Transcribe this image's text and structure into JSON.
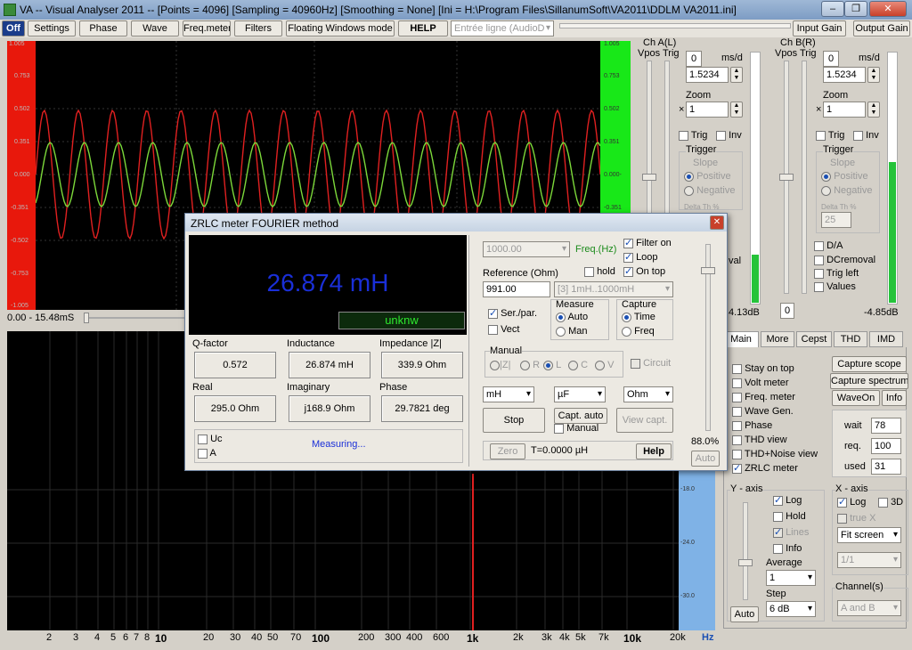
{
  "window": {
    "title": "VA -- Visual Analyser 2011 --  [Points = 4096]  [Sampling = 40960Hz]  [Smoothing = None]  [Ini = H:\\Program Files\\SillanumSoft\\VA2011\\DDLM VA2011.ini]",
    "minimize": "–",
    "maximize": "❐",
    "close": "✕"
  },
  "toolbar": {
    "off": "Off",
    "settings": "Settings",
    "phase": "Phase",
    "wave": "Wave",
    "freqmeter": "Freq.meter",
    "filters": "Filters",
    "floating": "Floating Windows mode",
    "help": "HELP",
    "input_select": "Entrée ligne (AudioD",
    "input_gain": "Input Gain",
    "output_gain": "Output Gain"
  },
  "scope": {
    "left_ticks": [
      "1.005",
      "0.753",
      "0.502",
      "0.351",
      "0.000",
      "-0.351",
      "-0.502",
      "-0.753",
      "-1.005"
    ],
    "right_ticks": [
      "1.005",
      "0.753",
      "0.502",
      "0.351",
      "0.000-",
      "-0.351"
    ],
    "time_range": "0.00 - 15.48mS"
  },
  "chA": {
    "title": "Ch A(L)",
    "vpos": "Vpos",
    "trig": "Trig",
    "ms_d_val": "0",
    "ms_d": "ms/d",
    "time": "1.5234",
    "zoom": "Zoom",
    "zoom_x": "×",
    "zoom_val": "1",
    "trig_cb": "Trig",
    "inv_cb": "Inv",
    "trigger": "Trigger",
    "slope": "Slope",
    "positive": "Positive",
    "negative": "Negative",
    "delta": "Delta Th %",
    "val_label": "val",
    "db": "4.13dB"
  },
  "chB": {
    "title": "Ch B(R)",
    "vpos": "Vpos",
    "trig": "Trig",
    "ms_d_val": "0",
    "ms_d": "ms/d",
    "time": "1.5234",
    "zoom": "Zoom",
    "zoom_x": "×",
    "zoom_val": "1",
    "trig_cb": "Trig",
    "inv_cb": "Inv",
    "trigger": "Trigger",
    "slope": "Slope",
    "positive": "Positive",
    "negative": "Negative",
    "delta": "Delta Th %",
    "delta_val": "25",
    "da": "D/A",
    "dcremoval": "DCremoval",
    "trigleft": "Trig left",
    "values": "Values",
    "zero": "0",
    "db": "-4.85dB"
  },
  "spectrum": {
    "db_ticks": [
      "-18.0",
      "-24.0",
      "-30.0"
    ],
    "x_ticks": [
      "2",
      "3",
      "4",
      "5",
      "6",
      "7",
      "8",
      "10",
      "20",
      "30",
      "40",
      "50",
      "70",
      "100",
      "200",
      "300",
      "400",
      "600",
      "1k",
      "2k",
      "3k",
      "4k",
      "5k",
      "7k",
      "10k",
      "20k"
    ],
    "hz": "Hz"
  },
  "tabs": [
    "Main",
    "More",
    "Cepst",
    "THD",
    "IMD"
  ],
  "main": {
    "stay_on_top": "Stay on top",
    "volt_meter": "Volt meter",
    "freq_meter": "Freq. meter",
    "wave_gen": "Wave Gen.",
    "phase": "Phase",
    "thd_view": "THD view",
    "thd_noise": "THD+Noise view",
    "zrlc": "ZRLC meter",
    "capt_scope": "Capture scope",
    "capt_spectrum": "Capture spectrum",
    "waveon": "WaveOn",
    "info": "Info",
    "wait_label": "wait",
    "wait": "78",
    "req_label": "req.",
    "req": "100",
    "used_label": "used",
    "used": "31"
  },
  "yaxis": {
    "title": "Y - axis",
    "log": "Log",
    "hold": "Hold",
    "lines": "Lines",
    "info": "Info",
    "average": "Average",
    "avg_val": "1",
    "step": "Step",
    "step_val": "6 dB",
    "auto": "Auto"
  },
  "xaxis": {
    "title": "X - axis",
    "log": "Log",
    "three_d": "3D",
    "truex": "true X",
    "fit": "Fit screen",
    "ratio": "1/1",
    "channels": "Channel(s)",
    "ch_val": "A and B"
  },
  "dialog": {
    "title": "ZRLC meter FOURIER method",
    "close": "✕",
    "value": "26.874 mH",
    "status": "unknw",
    "q_label": "Q-factor",
    "q": "0.572",
    "ind_label": "Inductance",
    "ind": "26.874 mH",
    "imp_label": "Impedance |Z|",
    "imp": "339.9 Ohm",
    "real_label": "Real",
    "real": "295.0 Ohm",
    "imag_label": "Imaginary",
    "imag": "j168.9 Ohm",
    "phase_label": "Phase",
    "phase": "29.7821 deg",
    "uc": "Uc",
    "a": "A",
    "measuring": "Measuring...",
    "freq_val": "1000.00",
    "freq": "Freq.(Hz)",
    "filter_on": "Filter on",
    "loop": "Loop",
    "on_top": "On top",
    "reference": "Reference (Ohm)",
    "hold": "hold",
    "ref_val": "991.00",
    "range": "[3]  1mH..1000mH",
    "serpar": "Ser./par.",
    "vect": "Vect",
    "measure": "Measure",
    "auto": "Auto",
    "man": "Man",
    "capture": "Capture",
    "time": "Time",
    "freq2": "Freq",
    "manual": "Manual",
    "z": "|Z|",
    "r": "R",
    "l": "L",
    "c": "C",
    "v": "V",
    "circuit": "Circuit",
    "unit_l": "mH",
    "unit_c": "µF",
    "unit_r": "Ohm",
    "stop": "Stop",
    "capt_auto": "Capt. auto",
    "manual_cb": "Manual",
    "view_capt": "View capt.",
    "pct": "88.0%",
    "auto_btn": "Auto",
    "zero": "Zero",
    "t": "T=0.0000 µH",
    "help": "Help"
  }
}
